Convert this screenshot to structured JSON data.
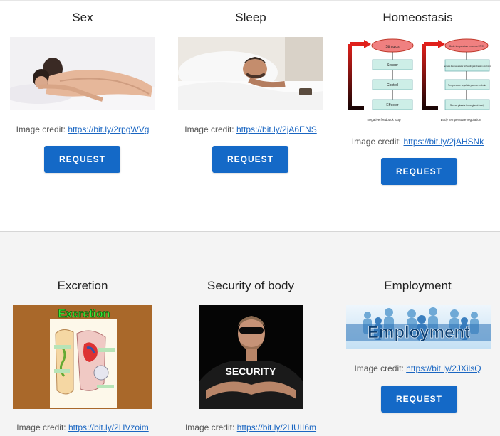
{
  "request_label": "REQUEST",
  "credit_prefix": "Image credit:",
  "colors": {
    "button": "#1469c7",
    "link": "#1a66c2",
    "bottom_section_bg": "#f4f4f4"
  },
  "cards": [
    {
      "title": "Sex",
      "credit_url": "https://bit.ly/2rpgWVg"
    },
    {
      "title": "Sleep",
      "credit_url": "https://bit.ly/2jA6ENS"
    },
    {
      "title": "Homeostasis",
      "credit_url": "https://bit.ly/2jAHSNk",
      "diagram": {
        "left_boxes": [
          "Stimulus",
          "Sensor",
          "Control",
          "Effector"
        ],
        "left_caption": "Negative feedback loop",
        "right_boxes": [
          "Body temperature exceeds 37°C",
          "Sensors like nerve cells with endings in the skin and brain",
          "Temperature regulatory center in brain",
          "Sweat glands throughout body"
        ],
        "right_caption": "Body temperature regulation"
      }
    },
    {
      "title": "Excretion",
      "credit_url": "https://bit.ly/2HVzoim",
      "image_heading": "Excretion"
    },
    {
      "title": "Security of body",
      "credit_url": "https://bit.ly/2HUII6m",
      "shirt_text": "SECURITY"
    },
    {
      "title": "Employment",
      "credit_url": "https://bit.ly/2JXilsQ",
      "banner_text": "Employment"
    }
  ]
}
